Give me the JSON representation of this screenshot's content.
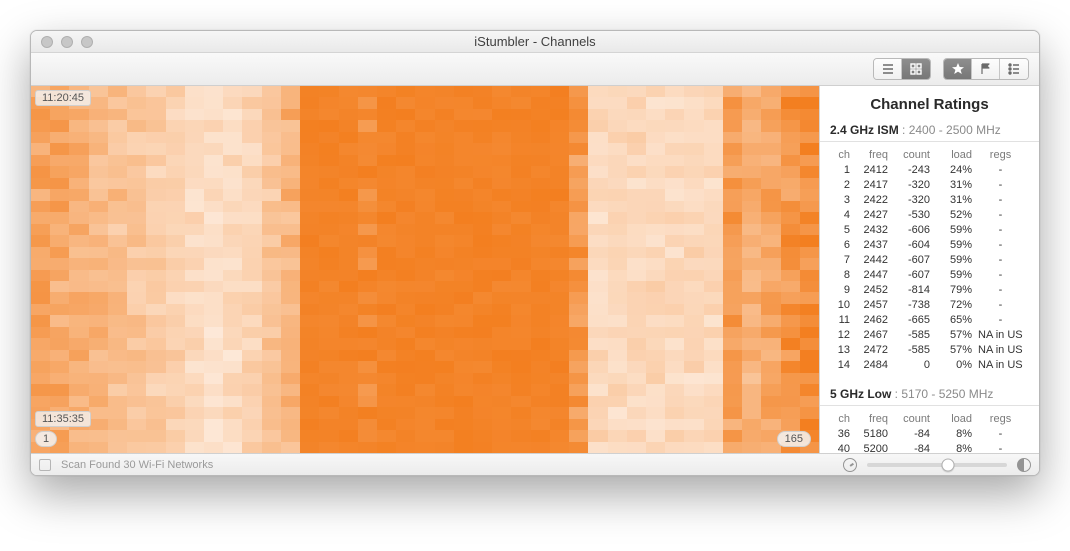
{
  "window": {
    "title": "iStumbler - Channels"
  },
  "toolbar": {
    "view_list_label": "list view",
    "view_grid_label": "grid view",
    "star_label": "favorites",
    "flag_label": "flagged",
    "lines_label": "details"
  },
  "heatmap": {
    "time_start": "11:20:45",
    "time_end": "11:35:35",
    "x_start": "1",
    "x_end": "165"
  },
  "chart_data": {
    "type": "heatmap",
    "x_axis": "channel",
    "y_axis": "time",
    "x_range": [
      1,
      165
    ],
    "y_range_labels": [
      "11:20:45",
      "11:35:35"
    ],
    "rows": 32,
    "columns_approx": 40,
    "intensity_scale": "signal load (lighter = lower, saturated orange = higher)",
    "note": "per-cell values not labeled on chart; visual pattern reproduced below from approximate column intensity profile",
    "column_intensity_profile": [
      0.75,
      0.68,
      0.62,
      0.55,
      0.5,
      0.45,
      0.4,
      0.35,
      0.28,
      0.25,
      0.28,
      0.35,
      0.45,
      0.6,
      1.0,
      1.0,
      1.0,
      0.92,
      1.0,
      1.0,
      1.0,
      1.0,
      1.0,
      1.0,
      1.0,
      1.0,
      0.95,
      0.95,
      0.8,
      0.3,
      0.3,
      0.3,
      0.3,
      0.3,
      0.3,
      0.3,
      0.75,
      0.62,
      0.7,
      0.82,
      0.9
    ]
  },
  "ratings": {
    "title": "Channel Ratings",
    "bands": [
      {
        "name": "2.4 GHz ISM",
        "range": "2400 - 2500 MHz",
        "columns": [
          "ch",
          "freq",
          "count",
          "load",
          "regs"
        ],
        "rows": [
          {
            "ch": "1",
            "freq": "2412",
            "count": "-243",
            "load": "24%",
            "regs": "-"
          },
          {
            "ch": "2",
            "freq": "2417",
            "count": "-320",
            "load": "31%",
            "regs": "-"
          },
          {
            "ch": "3",
            "freq": "2422",
            "count": "-320",
            "load": "31%",
            "regs": "-"
          },
          {
            "ch": "4",
            "freq": "2427",
            "count": "-530",
            "load": "52%",
            "regs": "-"
          },
          {
            "ch": "5",
            "freq": "2432",
            "count": "-606",
            "load": "59%",
            "regs": "-"
          },
          {
            "ch": "6",
            "freq": "2437",
            "count": "-604",
            "load": "59%",
            "regs": "-"
          },
          {
            "ch": "7",
            "freq": "2442",
            "count": "-607",
            "load": "59%",
            "regs": "-"
          },
          {
            "ch": "8",
            "freq": "2447",
            "count": "-607",
            "load": "59%",
            "regs": "-"
          },
          {
            "ch": "9",
            "freq": "2452",
            "count": "-814",
            "load": "79%",
            "regs": "-"
          },
          {
            "ch": "10",
            "freq": "2457",
            "count": "-738",
            "load": "72%",
            "regs": "-"
          },
          {
            "ch": "11",
            "freq": "2462",
            "count": "-665",
            "load": "65%",
            "regs": "-"
          },
          {
            "ch": "12",
            "freq": "2467",
            "count": "-585",
            "load": "57%",
            "regs": "NA in US"
          },
          {
            "ch": "13",
            "freq": "2472",
            "count": "-585",
            "load": "57%",
            "regs": "NA in US"
          },
          {
            "ch": "14",
            "freq": "2484",
            "count": "0",
            "load": "0%",
            "regs": "NA in US"
          }
        ]
      },
      {
        "name": "5 GHz Low",
        "range": "5170 - 5250 MHz",
        "columns": [
          "ch",
          "freq",
          "count",
          "load",
          "regs"
        ],
        "rows": [
          {
            "ch": "36",
            "freq": "5180",
            "count": "-84",
            "load": "8%",
            "regs": "-"
          },
          {
            "ch": "40",
            "freq": "5200",
            "count": "-84",
            "load": "8%",
            "regs": "-"
          }
        ]
      }
    ]
  },
  "status": {
    "message": "Scan Found 30 Wi-Fi Networks"
  }
}
